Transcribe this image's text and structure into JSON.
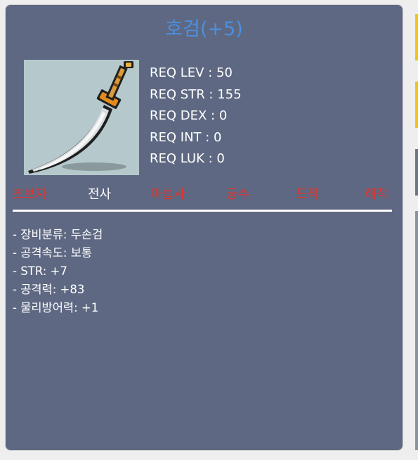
{
  "item": {
    "name": "호검(+5)"
  },
  "requirements": [
    {
      "label": "REQ LEV : 50"
    },
    {
      "label": "REQ STR : 155"
    },
    {
      "label": "REQ DEX : 0"
    },
    {
      "label": "REQ INT : 0"
    },
    {
      "label": "REQ LUK : 0"
    }
  ],
  "jobs": [
    {
      "label": "초보자",
      "allowed": false
    },
    {
      "label": "전사",
      "allowed": true
    },
    {
      "label": "마법사",
      "allowed": false
    },
    {
      "label": "궁수",
      "allowed": false
    },
    {
      "label": "도적",
      "allowed": false
    },
    {
      "label": "해적",
      "allowed": false
    }
  ],
  "stats": [
    "- 장비분류: 두손검",
    "- 공격속도: 보통",
    "- STR: +7",
    "- 공격력: +83",
    "- 물리방어력: +1"
  ],
  "colors": {
    "card_bg": "#5e6882",
    "title": "#4c8fe0",
    "job_allowed": "#ffffff",
    "job_denied": "#e0332b",
    "text": "#ffffff",
    "icon_bg": "#b5c9cc"
  },
  "icon": "curved-two-handed-sword-icon"
}
